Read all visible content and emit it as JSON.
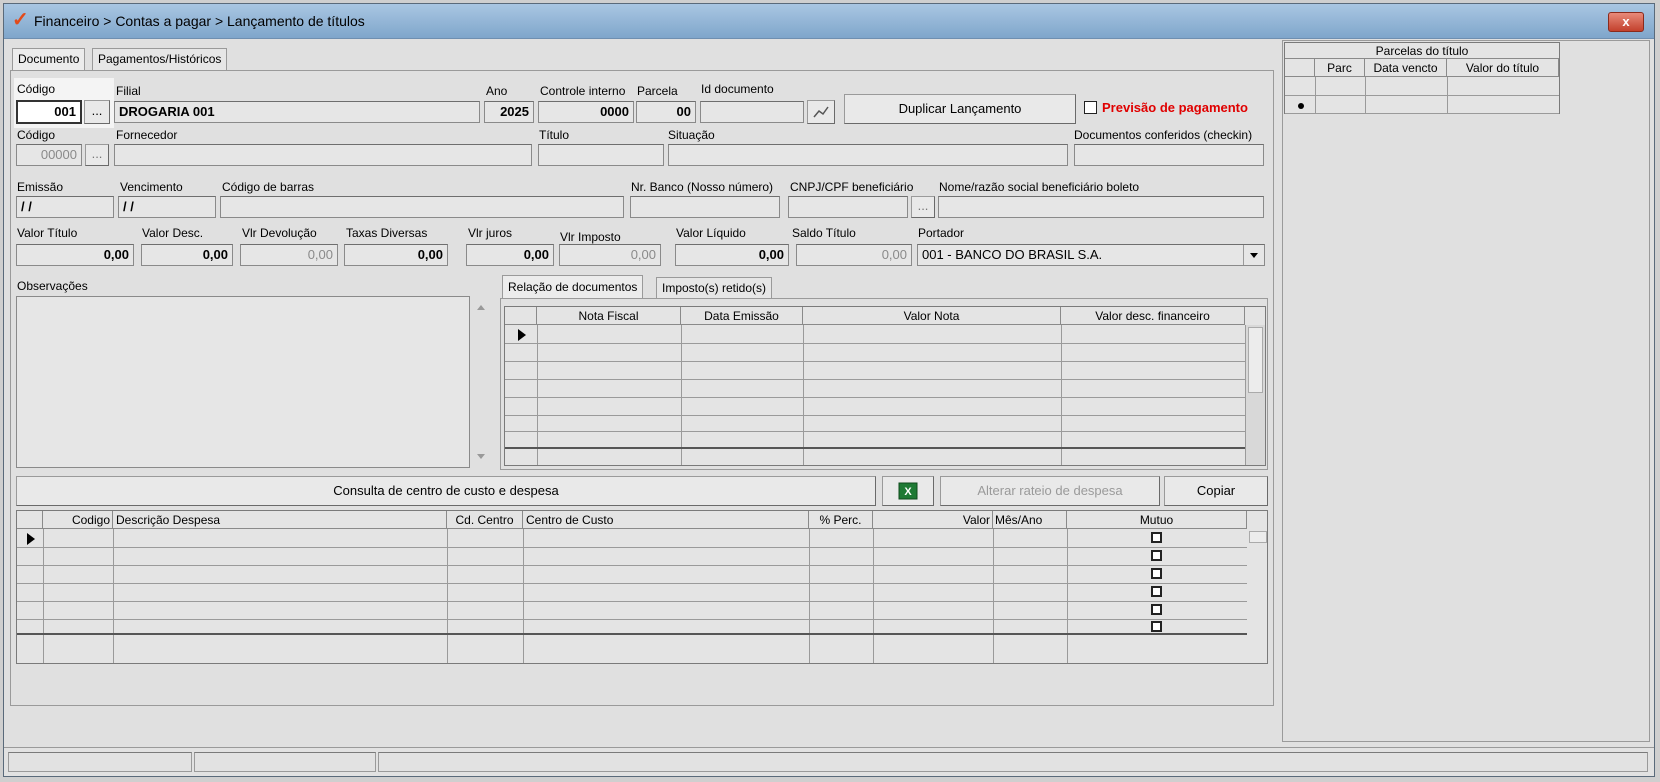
{
  "window": {
    "title": "Financeiro > Contas a pagar > Lançamento de títulos",
    "close_label": "x"
  },
  "tabs": {
    "documento": "Documento",
    "pagamentos": "Pagamentos/Históricos"
  },
  "row1": {
    "codigo_label": "Código",
    "codigo_value": "001",
    "ellipsis": "...",
    "filial_label": "Filial",
    "filial_value": "DROGARIA 001",
    "ano_label": "Ano",
    "ano_value": "2025",
    "controle_label": "Controle interno",
    "controle_value": "0000",
    "parcela_label": "Parcela",
    "parcela_value": "00",
    "iddoc_label": "Id documento",
    "iddoc_value": "",
    "duplicar_label": "Duplicar Lançamento",
    "previsao_label": "Previsão de pagamento"
  },
  "row2": {
    "codigo_label": "Código",
    "codigo_value": "00000",
    "fornecedor_label": "Fornecedor",
    "fornecedor_value": "",
    "titulo_label": "Título",
    "titulo_value": "",
    "situacao_label": "Situação",
    "situacao_value": "",
    "docs_label": "Documentos conferidos (checkin)",
    "docs_value": ""
  },
  "row3": {
    "emissao_label": "Emissão",
    "emissao_value": "/ /",
    "venc_label": "Vencimento",
    "venc_value": "/ /",
    "barras_label": "Código de barras",
    "barras_value": "",
    "nrbanco_label": "Nr. Banco (Nosso número)",
    "nrbanco_value": "",
    "cnpj_label": "CNPJ/CPF beneficiário",
    "cnpj_value": "",
    "nome_label": "Nome/razão social beneficiário boleto",
    "nome_value": ""
  },
  "row4": {
    "valor_titulo_label": "Valor Título",
    "valor_titulo": "0,00",
    "valor_desc_label": "Valor Desc.",
    "valor_desc": "0,00",
    "vlr_devol_label": "Vlr Devolução",
    "vlr_devol": "0,00",
    "taxas_label": "Taxas Diversas",
    "taxas": "0,00",
    "juros_label": "Vlr juros",
    "juros": "0,00",
    "imposto_label": "Vlr Imposto",
    "imposto": "0,00",
    "liquido_label": "Valor Líquido",
    "liquido": "0,00",
    "saldo_label": "Saldo Título",
    "saldo": "0,00",
    "portador_label": "Portador",
    "portador_value": "001 - BANCO DO BRASIL S.A."
  },
  "obs": {
    "label": "Observações"
  },
  "docs_tabs": {
    "relacao": "Relação de documentos",
    "impostos": "Imposto(s) retido(s)"
  },
  "docs_grid": {
    "headers": [
      "Nota Fiscal",
      "Data Emissão",
      "Valor Nota",
      "Valor desc. financeiro"
    ]
  },
  "buttons": {
    "consulta": "Consulta de centro de custo e despesa",
    "alterar": "Alterar rateio de despesa",
    "copiar": "Copiar"
  },
  "despesa_grid": {
    "headers": [
      "Codigo",
      "Descrição Despesa",
      "Cd. Centro",
      "Centro de Custo",
      "% Perc.",
      "Valor",
      "Mês/Ano",
      "Mutuo"
    ]
  },
  "parcelas": {
    "title": "Parcelas do título",
    "headers": [
      "Parc",
      "Data vencto",
      "Valor do título"
    ]
  },
  "colors": {
    "accent_red": "#e00000",
    "title_bar": "#9dbcdc"
  }
}
